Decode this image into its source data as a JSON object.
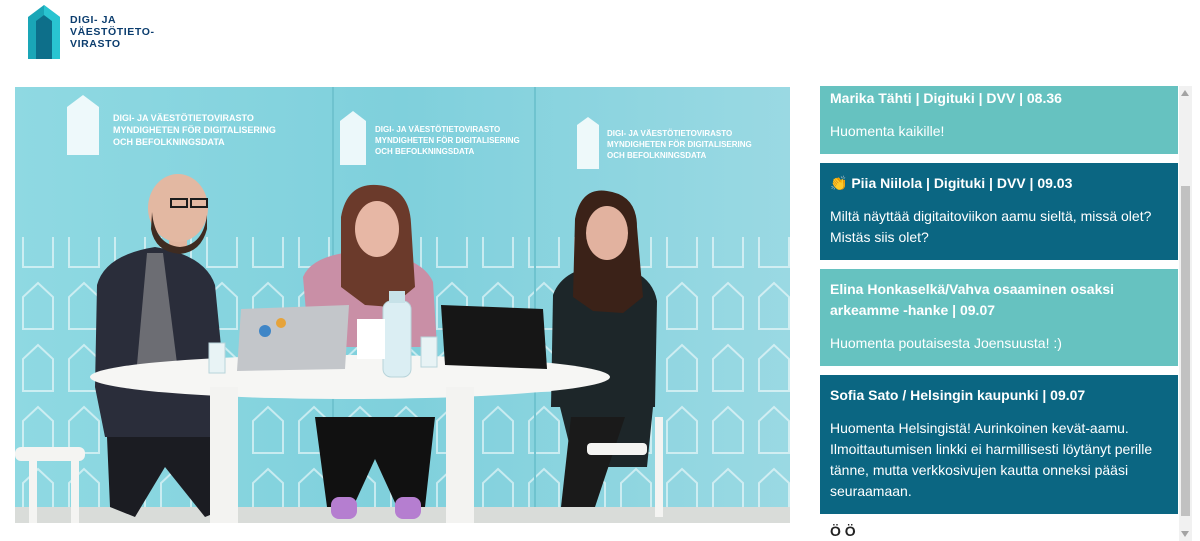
{
  "header": {
    "logo_lines": [
      "DIGI- JA",
      "VÄESTÖTIETO-",
      "VIRASTO"
    ]
  },
  "video": {
    "backdrop_lines": [
      "DIGI- JA VÄESTÖTIETOVIRASTO",
      "MYNDIGHETEN FÖR DIGITALISERING",
      "OCH BEFOLKNINGSDATA"
    ]
  },
  "chat": {
    "messages": [
      {
        "author": "Marika Tähti | Digituki | DVV | 08.36",
        "text": "Huomenta kaikille!",
        "style": "light"
      },
      {
        "author": "👏 Piia Niilola | Digituki | DVV | 09.03",
        "text": "Miltä näyttää digitaitoviikon aamu sieltä, missä olet? Mistäs siis olet?",
        "style": "dark"
      },
      {
        "author": "Elina Honkaselkä/Vahva osaaminen osaksi arkeamme -hanke | 09.07",
        "text": "Huomenta poutaisesta Joensuusta! :)",
        "style": "light"
      },
      {
        "author": "Sofia Sato / Helsingin kaupunki | 09.07",
        "text": "Huomenta Helsingistä! Aurinkoinen kevät-aamu. Ilmoittautumisen linkki ei harmillisesti löytänyt perille tänne, mutta verkkosivujen kautta onneksi pääsi seuraamaan.",
        "style": "dark"
      }
    ],
    "partial_next": "Ö Ö"
  },
  "colors": {
    "light_msg": "#66c2c0",
    "dark_msg": "#0b6682",
    "brand": "#0b3d6e"
  }
}
